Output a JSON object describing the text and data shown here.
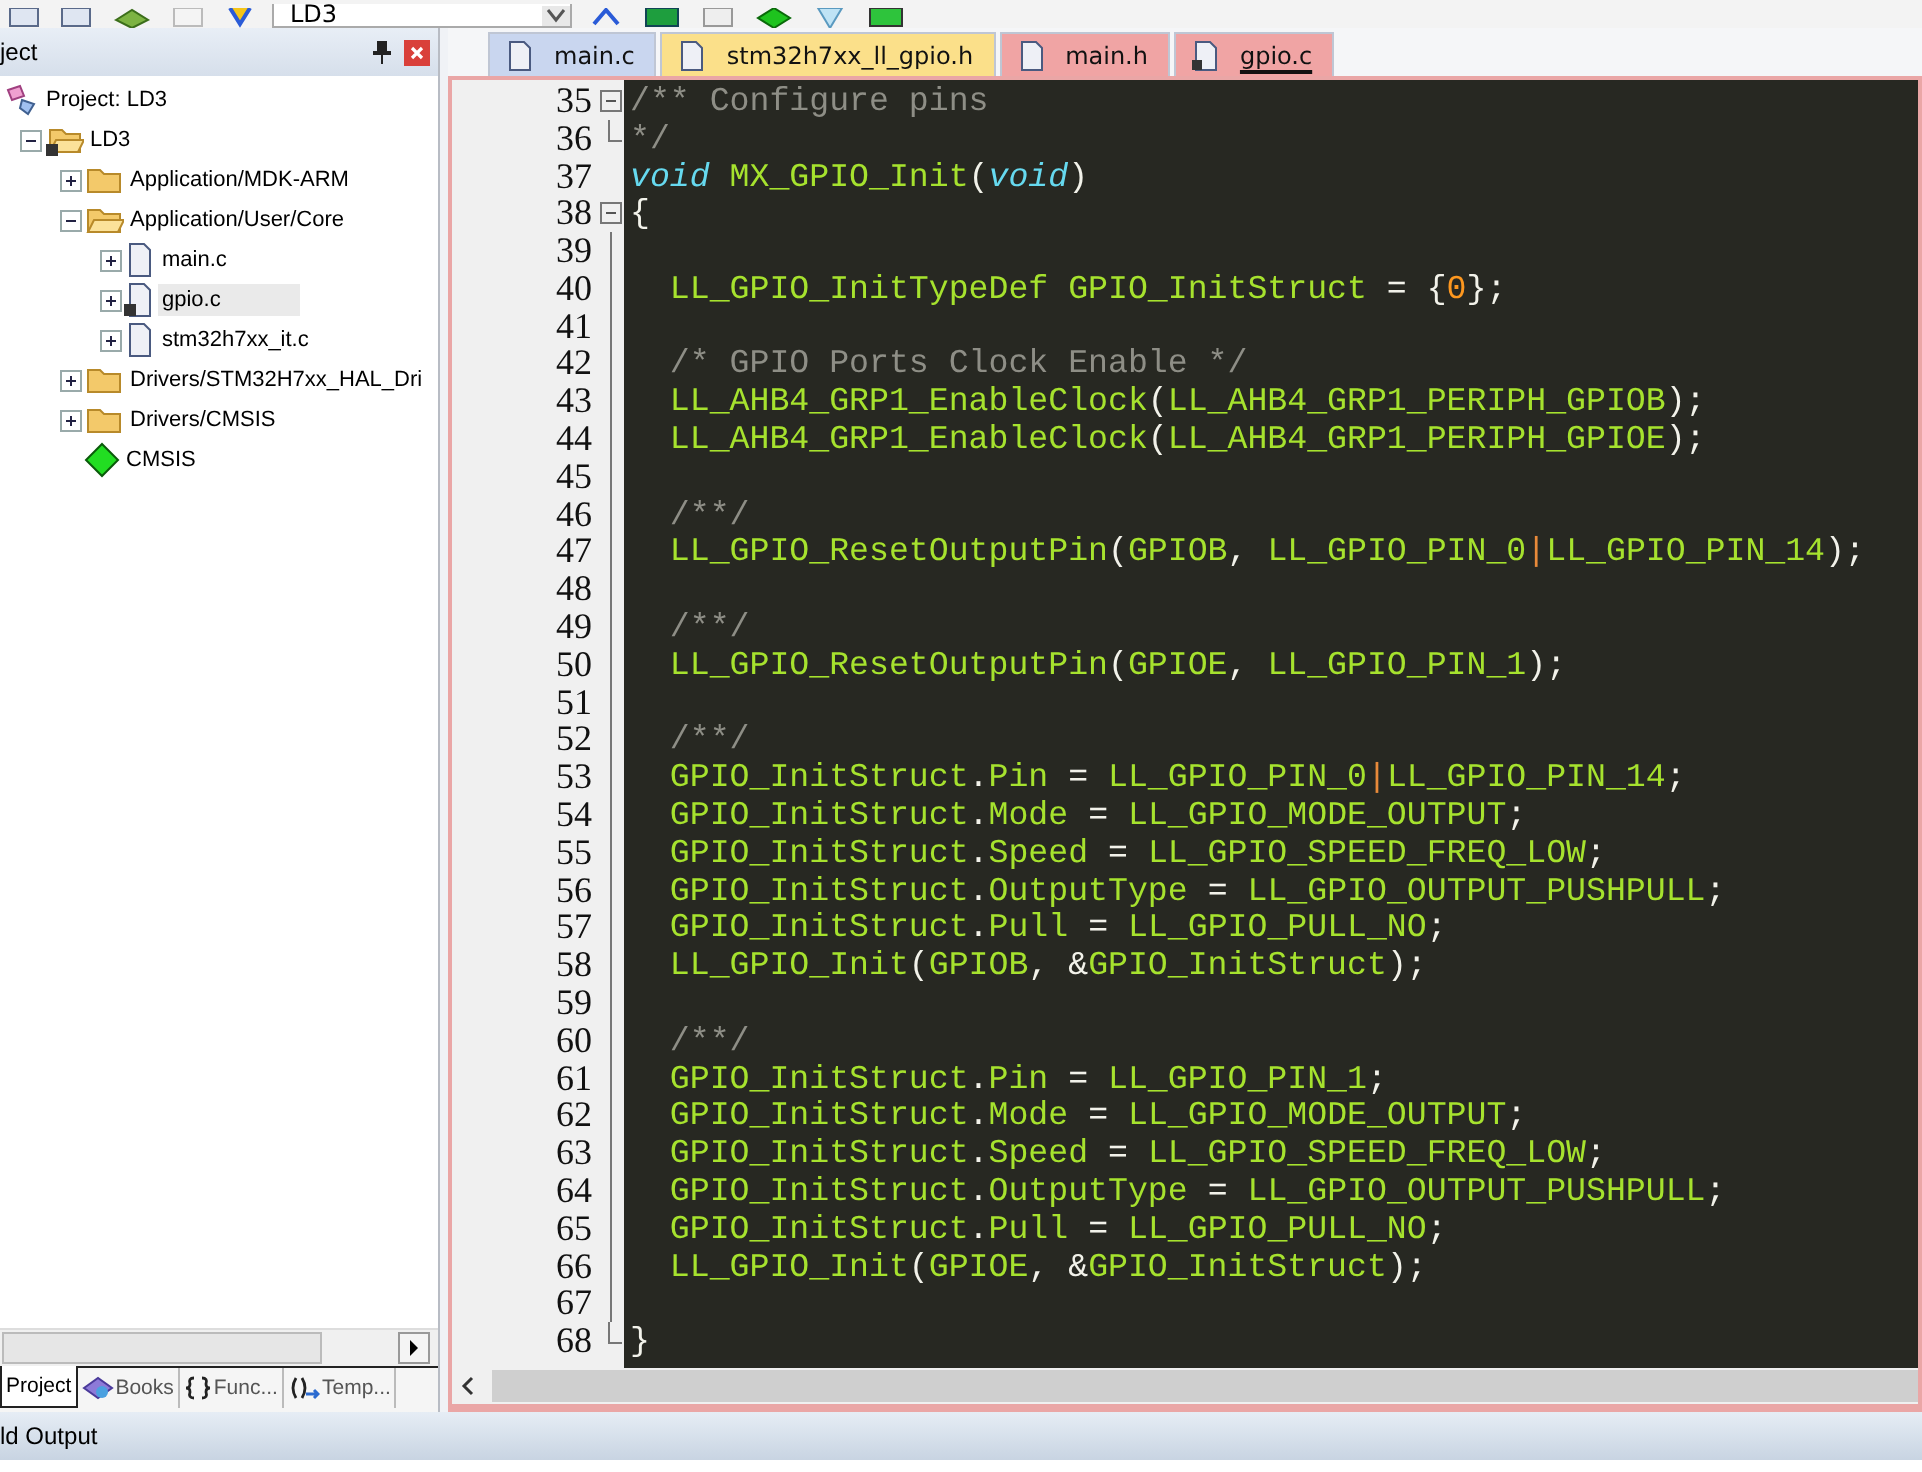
{
  "toolbar": {
    "target": "LD3"
  },
  "project_panel": {
    "title": "ject",
    "tree": [
      {
        "label": "Project: LD3",
        "kind": "project",
        "selected": false,
        "children": [
          {
            "label": "LD3",
            "kind": "target",
            "expanded": true,
            "selected": false,
            "children": [
              {
                "label": "Application/MDK-ARM",
                "kind": "folder",
                "expanded": false,
                "selected": false
              },
              {
                "label": "Application/User/Core",
                "kind": "folder",
                "expanded": true,
                "selected": false,
                "children": [
                  {
                    "label": "main.c",
                    "kind": "file",
                    "expanded": false,
                    "selected": false
                  },
                  {
                    "label": "gpio.c",
                    "kind": "file",
                    "expanded": false,
                    "selected": true
                  },
                  {
                    "label": "stm32h7xx_it.c",
                    "kind": "file",
                    "expanded": false,
                    "selected": false
                  }
                ]
              },
              {
                "label": "Drivers/STM32H7xx_HAL_Dri",
                "kind": "folder",
                "expanded": false,
                "selected": false
              },
              {
                "label": "Drivers/CMSIS",
                "kind": "folder",
                "expanded": false,
                "selected": false
              },
              {
                "label": "CMSIS",
                "kind": "component",
                "selected": false
              }
            ]
          }
        ]
      }
    ],
    "tabs": [
      {
        "label": "Project",
        "kind": "project",
        "selected": true
      },
      {
        "label": "Books",
        "kind": "books",
        "selected": false
      },
      {
        "label": "Func...",
        "kind": "functions",
        "selected": false
      },
      {
        "label": "Temp...",
        "kind": "templates",
        "selected": false
      }
    ]
  },
  "editor": {
    "tabs": [
      {
        "label": "main.c",
        "color": "#c9d6ef",
        "selected": false
      },
      {
        "label": "stm32h7xx_ll_gpio.h",
        "color": "#fbe08a",
        "selected": false
      },
      {
        "label": "main.h",
        "color": "#f0a4a4",
        "selected": false
      },
      {
        "label": "gpio.c",
        "color": "#f0a4a4",
        "selected": true
      }
    ],
    "lines": [
      {
        "number": "35",
        "kind": "open",
        "segments": [
          {
            "kind": "comment",
            "text": "/** Configure pins"
          }
        ]
      },
      {
        "number": "36",
        "kind": "close",
        "segments": [
          {
            "kind": "comment",
            "text": "*/"
          }
        ]
      },
      {
        "number": "37",
        "kind": "plain",
        "segments": [
          {
            "kind": "keyword",
            "text": "void"
          },
          {
            "kind": "ident",
            "text": " MX_GPIO_Init"
          },
          {
            "kind": "punct",
            "text": "("
          },
          {
            "kind": "keyword",
            "text": "void"
          },
          {
            "kind": "punct",
            "text": ")"
          }
        ]
      },
      {
        "number": "38",
        "kind": "open",
        "segments": [
          {
            "kind": "punct",
            "text": "{"
          }
        ]
      },
      {
        "number": "39",
        "kind": "inner"
      },
      {
        "number": "40",
        "kind": "inner",
        "segments": [
          {
            "kind": "ident",
            "text": "  LL_GPIO_InitTypeDef GPIO_InitStruct "
          },
          {
            "kind": "punct",
            "text": "= {"
          },
          {
            "kind": "number",
            "text": "0"
          },
          {
            "kind": "punct",
            "text": "};"
          }
        ]
      },
      {
        "number": "41",
        "kind": "inner"
      },
      {
        "number": "42",
        "kind": "inner",
        "segments": [
          {
            "kind": "comment",
            "text": "  /* GPIO Ports Clock Enable */"
          }
        ]
      },
      {
        "number": "43",
        "kind": "inner",
        "segments": [
          {
            "kind": "ident",
            "text": "  LL_AHB4_GRP1_EnableClock"
          },
          {
            "kind": "punct",
            "text": "("
          },
          {
            "kind": "ident",
            "text": "LL_AHB4_GRP1_PERIPH_GPIOB"
          },
          {
            "kind": "punct",
            "text": ");"
          }
        ]
      },
      {
        "number": "44",
        "kind": "inner",
        "segments": [
          {
            "kind": "ident",
            "text": "  LL_AHB4_GRP1_EnableClock"
          },
          {
            "kind": "punct",
            "text": "("
          },
          {
            "kind": "ident",
            "text": "LL_AHB4_GRP1_PERIPH_GPIOE"
          },
          {
            "kind": "punct",
            "text": ");"
          }
        ]
      },
      {
        "number": "45",
        "kind": "inner"
      },
      {
        "number": "46",
        "kind": "inner",
        "segments": [
          {
            "kind": "comment",
            "text": "  /**/"
          }
        ]
      },
      {
        "number": "47",
        "kind": "inner",
        "segments": [
          {
            "kind": "ident",
            "text": "  LL_GPIO_ResetOutputPin"
          },
          {
            "kind": "punct",
            "text": "("
          },
          {
            "kind": "ident",
            "text": "GPIOB"
          },
          {
            "kind": "punct",
            "text": ", "
          },
          {
            "kind": "ident",
            "text": "LL_GPIO_PIN_0"
          },
          {
            "kind": "operator",
            "text": "|"
          },
          {
            "kind": "ident",
            "text": "LL_GPIO_PIN_14"
          },
          {
            "kind": "punct",
            "text": ");"
          }
        ]
      },
      {
        "number": "48",
        "kind": "inner"
      },
      {
        "number": "49",
        "kind": "inner",
        "segments": [
          {
            "kind": "comment",
            "text": "  /**/"
          }
        ]
      },
      {
        "number": "50",
        "kind": "inner",
        "segments": [
          {
            "kind": "ident",
            "text": "  LL_GPIO_ResetOutputPin"
          },
          {
            "kind": "punct",
            "text": "("
          },
          {
            "kind": "ident",
            "text": "GPIOE"
          },
          {
            "kind": "punct",
            "text": ", "
          },
          {
            "kind": "ident",
            "text": "LL_GPIO_PIN_1"
          },
          {
            "kind": "punct",
            "text": ");"
          }
        ]
      },
      {
        "number": "51",
        "kind": "inner"
      },
      {
        "number": "52",
        "kind": "inner",
        "segments": [
          {
            "kind": "comment",
            "text": "  /**/"
          }
        ]
      },
      {
        "number": "53",
        "kind": "inner",
        "segments": [
          {
            "kind": "ident",
            "text": "  GPIO_InitStruct"
          },
          {
            "kind": "punct",
            "text": "."
          },
          {
            "kind": "ident",
            "text": "Pin"
          },
          {
            "kind": "punct",
            "text": " = "
          },
          {
            "kind": "ident",
            "text": "LL_GPIO_PIN_0"
          },
          {
            "kind": "operator",
            "text": "|"
          },
          {
            "kind": "ident",
            "text": "LL_GPIO_PIN_14"
          },
          {
            "kind": "punct",
            "text": ";"
          }
        ]
      },
      {
        "number": "54",
        "kind": "inner",
        "segments": [
          {
            "kind": "ident",
            "text": "  GPIO_InitStruct"
          },
          {
            "kind": "punct",
            "text": "."
          },
          {
            "kind": "ident",
            "text": "Mode"
          },
          {
            "kind": "punct",
            "text": " = "
          },
          {
            "kind": "ident",
            "text": "LL_GPIO_MODE_OUTPUT"
          },
          {
            "kind": "punct",
            "text": ";"
          }
        ]
      },
      {
        "number": "55",
        "kind": "inner",
        "segments": [
          {
            "kind": "ident",
            "text": "  GPIO_InitStruct"
          },
          {
            "kind": "punct",
            "text": "."
          },
          {
            "kind": "ident",
            "text": "Speed"
          },
          {
            "kind": "punct",
            "text": " = "
          },
          {
            "kind": "ident",
            "text": "LL_GPIO_SPEED_FREQ_LOW"
          },
          {
            "kind": "punct",
            "text": ";"
          }
        ]
      },
      {
        "number": "56",
        "kind": "inner",
        "segments": [
          {
            "kind": "ident",
            "text": "  GPIO_InitStruct"
          },
          {
            "kind": "punct",
            "text": "."
          },
          {
            "kind": "ident",
            "text": "OutputType"
          },
          {
            "kind": "punct",
            "text": " = "
          },
          {
            "kind": "ident",
            "text": "LL_GPIO_OUTPUT_PUSHPULL"
          },
          {
            "kind": "punct",
            "text": ";"
          }
        ]
      },
      {
        "number": "57",
        "kind": "inner",
        "segments": [
          {
            "kind": "ident",
            "text": "  GPIO_InitStruct"
          },
          {
            "kind": "punct",
            "text": "."
          },
          {
            "kind": "ident",
            "text": "Pull"
          },
          {
            "kind": "punct",
            "text": " = "
          },
          {
            "kind": "ident",
            "text": "LL_GPIO_PULL_NO"
          },
          {
            "kind": "punct",
            "text": ";"
          }
        ]
      },
      {
        "number": "58",
        "kind": "inner",
        "segments": [
          {
            "kind": "ident",
            "text": "  LL_GPIO_Init"
          },
          {
            "kind": "punct",
            "text": "("
          },
          {
            "kind": "ident",
            "text": "GPIOB"
          },
          {
            "kind": "punct",
            "text": ", &"
          },
          {
            "kind": "ident",
            "text": "GPIO_InitStruct"
          },
          {
            "kind": "punct",
            "text": ");"
          }
        ]
      },
      {
        "number": "59",
        "kind": "inner"
      },
      {
        "number": "60",
        "kind": "inner",
        "segments": [
          {
            "kind": "comment",
            "text": "  /**/"
          }
        ]
      },
      {
        "number": "61",
        "kind": "inner",
        "segments": [
          {
            "kind": "ident",
            "text": "  GPIO_InitStruct"
          },
          {
            "kind": "punct",
            "text": "."
          },
          {
            "kind": "ident",
            "text": "Pin"
          },
          {
            "kind": "punct",
            "text": " = "
          },
          {
            "kind": "ident",
            "text": "LL_GPIO_PIN_1"
          },
          {
            "kind": "punct",
            "text": ";"
          }
        ]
      },
      {
        "number": "62",
        "kind": "inner",
        "segments": [
          {
            "kind": "ident",
            "text": "  GPIO_InitStruct"
          },
          {
            "kind": "punct",
            "text": "."
          },
          {
            "kind": "ident",
            "text": "Mode"
          },
          {
            "kind": "punct",
            "text": " = "
          },
          {
            "kind": "ident",
            "text": "LL_GPIO_MODE_OUTPUT"
          },
          {
            "kind": "punct",
            "text": ";"
          }
        ]
      },
      {
        "number": "63",
        "kind": "inner",
        "segments": [
          {
            "kind": "ident",
            "text": "  GPIO_InitStruct"
          },
          {
            "kind": "punct",
            "text": "."
          },
          {
            "kind": "ident",
            "text": "Speed"
          },
          {
            "kind": "punct",
            "text": " = "
          },
          {
            "kind": "ident",
            "text": "LL_GPIO_SPEED_FREQ_LOW"
          },
          {
            "kind": "punct",
            "text": ";"
          }
        ]
      },
      {
        "number": "64",
        "kind": "inner",
        "segments": [
          {
            "kind": "ident",
            "text": "  GPIO_InitStruct"
          },
          {
            "kind": "punct",
            "text": "."
          },
          {
            "kind": "ident",
            "text": "OutputType"
          },
          {
            "kind": "punct",
            "text": " = "
          },
          {
            "kind": "ident",
            "text": "LL_GPIO_OUTPUT_PUSHPULL"
          },
          {
            "kind": "punct",
            "text": ";"
          }
        ]
      },
      {
        "number": "65",
        "kind": "inner",
        "segments": [
          {
            "kind": "ident",
            "text": "  GPIO_InitStruct"
          },
          {
            "kind": "punct",
            "text": "."
          },
          {
            "kind": "ident",
            "text": "Pull"
          },
          {
            "kind": "punct",
            "text": " = "
          },
          {
            "kind": "ident",
            "text": "LL_GPIO_PULL_NO"
          },
          {
            "kind": "punct",
            "text": ";"
          }
        ]
      },
      {
        "number": "66",
        "kind": "inner",
        "segments": [
          {
            "kind": "ident",
            "text": "  LL_GPIO_Init"
          },
          {
            "kind": "punct",
            "text": "("
          },
          {
            "kind": "ident",
            "text": "GPIOE"
          },
          {
            "kind": "punct",
            "text": ", &"
          },
          {
            "kind": "ident",
            "text": "GPIO_InitStruct"
          },
          {
            "kind": "punct",
            "text": ");"
          }
        ]
      },
      {
        "number": "67",
        "kind": "inner"
      },
      {
        "number": "68",
        "kind": "close",
        "segments": [
          {
            "kind": "punct",
            "text": "}"
          }
        ]
      }
    ]
  },
  "output_panel": {
    "title": "ld Output"
  }
}
